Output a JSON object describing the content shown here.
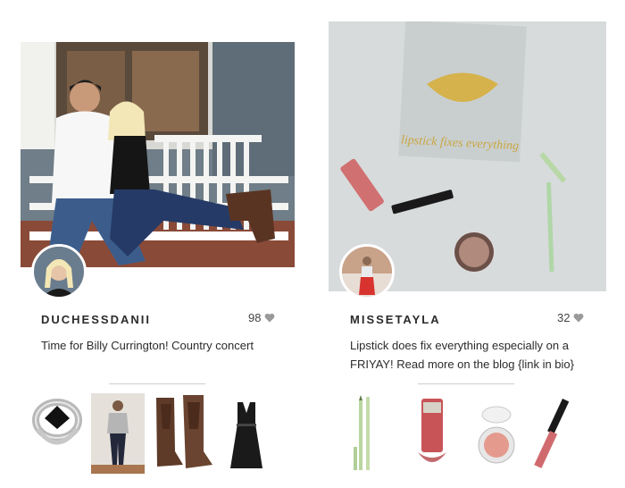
{
  "posts": [
    {
      "username": "DUCHESSDANII",
      "likes": "98",
      "caption": "Time for Billy Currington! Country concert",
      "products": [
        {
          "name": "black-onyx-ring"
        },
        {
          "name": "grey-top-jeans-outfit"
        },
        {
          "name": "brown-cowboy-boots"
        },
        {
          "name": "black-leather-dress"
        }
      ]
    },
    {
      "username": "MISSETAYLA",
      "likes": "32",
      "caption": "Lipstick does fix everything especially on a FRIYAY! Read more on the blog {link in bio}",
      "photo_box_text": "lipstick fixes everything",
      "products": [
        {
          "name": "green-liner-pencils"
        },
        {
          "name": "lip-gloss-tube"
        },
        {
          "name": "blush-compact"
        },
        {
          "name": "lip-gloss-wand"
        }
      ]
    }
  ],
  "colors": {
    "heart": "#9a9a9a",
    "divider": "#cfcfcf"
  }
}
